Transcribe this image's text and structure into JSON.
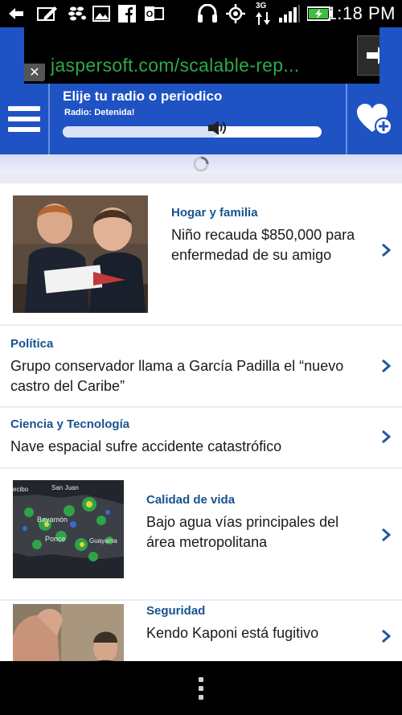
{
  "status_bar": {
    "time": "1:18 PM",
    "network_type": "3G",
    "icons": [
      "back-arrow-icon",
      "edit-icon",
      "blackberry-messenger-icon",
      "gallery-icon",
      "facebook-icon",
      "outlook-icon",
      "headset-icon",
      "gps-icon",
      "signal-icon",
      "battery-icon"
    ]
  },
  "ad": {
    "url_text": "jaspersoft.com/scalable-rep...",
    "close_label": "✕"
  },
  "header": {
    "title": "Elije tu radio o periodico",
    "radio_status": "Radio: Detenida!",
    "volume_level": 0.6
  },
  "colors": {
    "brand_blue": "#1f53c4",
    "category_blue": "#17538f",
    "ad_green": "#2fa84a"
  },
  "feed": {
    "items": [
      {
        "category": "Hogar y familia",
        "headline": "Niño recauda $850,000 para enfermedad de su amigo",
        "thumbnail": "two-boys-photo"
      },
      {
        "category": "Política",
        "headline": "Grupo conservador llama a García Padilla el “nuevo castro del Caribe”",
        "thumbnail": ""
      },
      {
        "category": "Ciencia y Tecnología",
        "headline": "Nave espacial sufre accidente catastrófico",
        "thumbnail": ""
      },
      {
        "category": "Calidad de vida",
        "headline": "Bajo agua vías principales del área metropolitana",
        "thumbnail": "radar-map-photo",
        "map_labels": [
          "ecibo",
          "San Juan",
          "Bayamón",
          "Ponce",
          "Guayama"
        ]
      },
      {
        "category": "Seguridad",
        "headline": "Kendo Kaponi está fugitivo",
        "thumbnail": "people-photo"
      }
    ]
  }
}
